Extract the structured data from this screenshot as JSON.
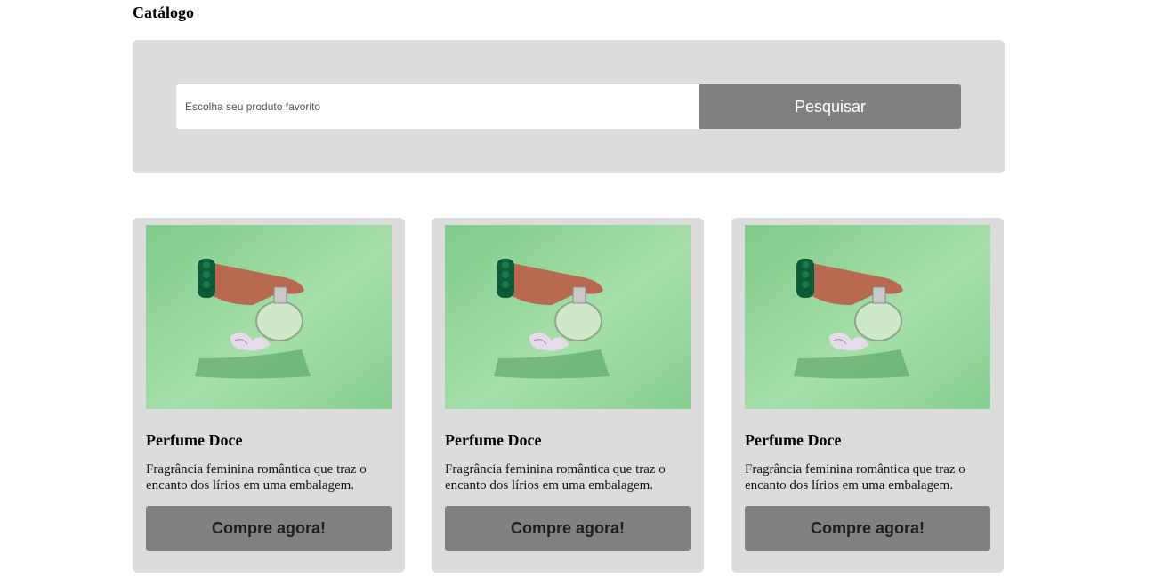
{
  "page": {
    "title": "Catálogo"
  },
  "search": {
    "placeholder": "Escolha seu produto favorito",
    "button_label": "Pesquisar"
  },
  "products": [
    {
      "name": "Perfume Doce",
      "description": "Fragrância feminina romântica que traz o encanto dos lírios em uma embalagem.",
      "button_label": "Compre agora!",
      "image": "perfume-bottle-photo"
    },
    {
      "name": "Perfume Doce",
      "description": "Fragrância feminina romântica que traz o encanto dos lírios em uma embalagem.",
      "button_label": "Compre agora!",
      "image": "perfume-bottle-photo"
    },
    {
      "name": "Perfume Doce",
      "description": "Fragrância feminina romântica que traz o encanto dos lírios em uma embalagem.",
      "button_label": "Compre agora!",
      "image": "perfume-bottle-photo"
    }
  ],
  "colors": {
    "panel_background": "#dcdcdc",
    "button_background": "#808080",
    "photo_background": "#8fd49a"
  }
}
